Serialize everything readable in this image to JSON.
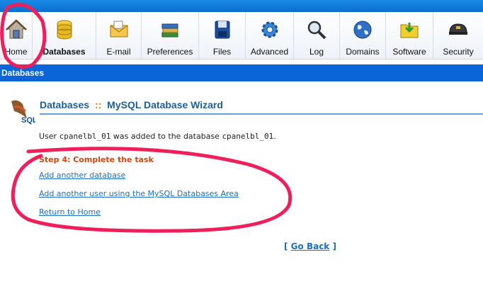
{
  "toolbar": {
    "items": [
      {
        "label": "Home",
        "icon": "home-icon"
      },
      {
        "label": "Databases",
        "icon": "databases-icon"
      },
      {
        "label": "E-mail",
        "icon": "email-icon"
      },
      {
        "label": "Preferences",
        "icon": "preferences-icon"
      },
      {
        "label": "Files",
        "icon": "files-icon"
      },
      {
        "label": "Advanced",
        "icon": "gear-icon"
      },
      {
        "label": "Log",
        "icon": "magnifier-icon"
      },
      {
        "label": "Domains",
        "icon": "globe-icon"
      },
      {
        "label": "Software",
        "icon": "software-folder-icon"
      },
      {
        "label": "Security",
        "icon": "security-helmet-icon"
      }
    ]
  },
  "section": {
    "title": "Databases"
  },
  "page": {
    "heading": "Databases",
    "separator": "::",
    "subheading": "MySQL Database Wizard",
    "logo_text": "SQL"
  },
  "message": {
    "prefix": "User ",
    "user": "cpanelbl_01",
    "middle": " was added to the database ",
    "database": "cpanelbl_01",
    "suffix": "."
  },
  "step": {
    "label": "Step 4: Complete the task"
  },
  "links": {
    "add_database": "Add another database",
    "add_user": "Add another user using the MySQL Databases Area",
    "return_home": "Return to Home"
  },
  "goback": {
    "open": "[ ",
    "label": "Go Back",
    "close": " ]"
  },
  "colors": {
    "accent": "#0a66d8",
    "heading": "#1e5f9a",
    "step": "#d0460e",
    "link": "#1a6fc0",
    "annotation": "#ee1f5a"
  }
}
